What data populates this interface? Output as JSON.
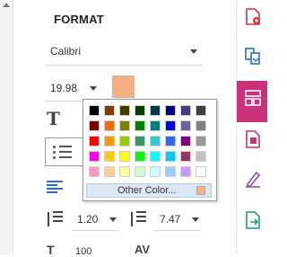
{
  "format": {
    "title": "FORMAT",
    "font_family": "Calibri",
    "font_size": "19.98",
    "text_color": "#f4b083",
    "line_spacing": "1.20",
    "paragraph_spacing": "7.47",
    "bottom_values": {
      "scale": "100",
      "kerning_label": "AV"
    }
  },
  "color_picker": {
    "rows": [
      [
        "#000000",
        "#7f3f00",
        "#3f3f00",
        "#003f00",
        "#003f3f",
        "#00007f",
        "#3f3f7f",
        "#3f3f3f"
      ],
      [
        "#7f0000",
        "#ff6600",
        "#7f7f00",
        "#007f00",
        "#007f7f",
        "#0000ff",
        "#66669a",
        "#7f7f7f"
      ],
      [
        "#ff0000",
        "#ff9900",
        "#99cc00",
        "#339966",
        "#33cccc",
        "#3366ff",
        "#7f007f",
        "#999999"
      ],
      [
        "#ff00ff",
        "#ffcc00",
        "#ffff00",
        "#00ff00",
        "#00ffff",
        "#00ccff",
        "#993366",
        "#c0c0c0"
      ],
      [
        "#ff99cc",
        "#ffcc99",
        "#ffff99",
        "#ccffcc",
        "#ccffff",
        "#99ccff",
        "#cc99ff",
        "#ffffff"
      ]
    ],
    "other_label": "Other Color...",
    "current_color": "#f4b083"
  },
  "tools": [
    {
      "icon": "pdf-export-icon",
      "color": "#d8343f",
      "active": false
    },
    {
      "icon": "combine-files-icon",
      "color": "#2a6cd0",
      "active": false
    },
    {
      "icon": "organize-pages-icon",
      "color": "#ffffff",
      "active": true
    },
    {
      "icon": "compress-pdf-icon",
      "color": "#c93279",
      "active": false
    },
    {
      "icon": "fill-sign-icon",
      "color": "#8a4bc6",
      "active": false
    },
    {
      "icon": "export-pdf-icon",
      "color": "#1a9d78",
      "active": false
    }
  ]
}
